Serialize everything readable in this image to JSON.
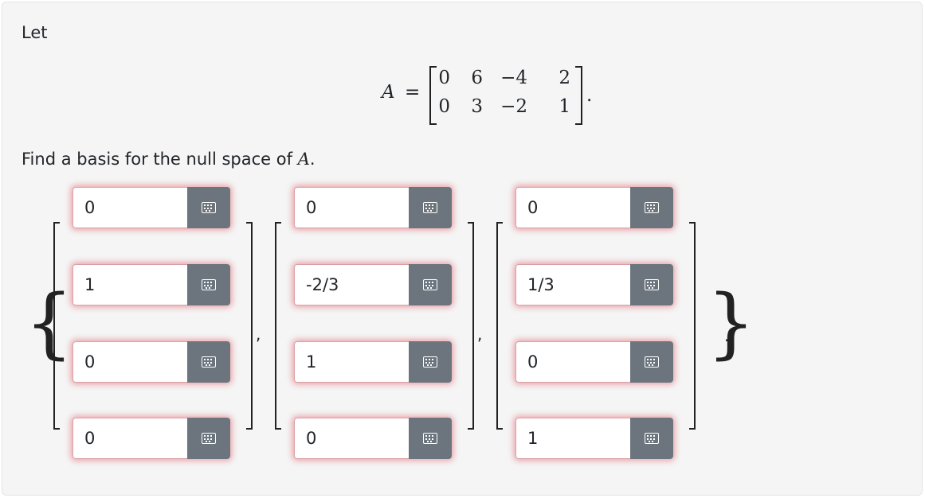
{
  "intro_text": "Let",
  "prompt_text": "Find a basis for the null space of",
  "prompt_symbol": "A",
  "prompt_period": ".",
  "matrix": {
    "name": "A",
    "equals": "=",
    "rows": [
      [
        "0",
        "6",
        "−4",
        "2"
      ],
      [
        "0",
        "3",
        "−2",
        "1"
      ]
    ],
    "terminator": "."
  },
  "basis": {
    "open_brace": "{",
    "close_brace": "}",
    "terminator": ".",
    "separator": ",",
    "vectors": [
      [
        "0",
        "1",
        "0",
        "0"
      ],
      [
        "0",
        "-2/3",
        "1",
        "0"
      ],
      [
        "0",
        "1/3",
        "0",
        "1"
      ]
    ]
  },
  "icons": {
    "entry_button": "keyboard-icon"
  },
  "colors": {
    "panel_bg": "#f5f5f5",
    "button_bg": "#6c757d",
    "invalid_glow": "#dc3545"
  }
}
